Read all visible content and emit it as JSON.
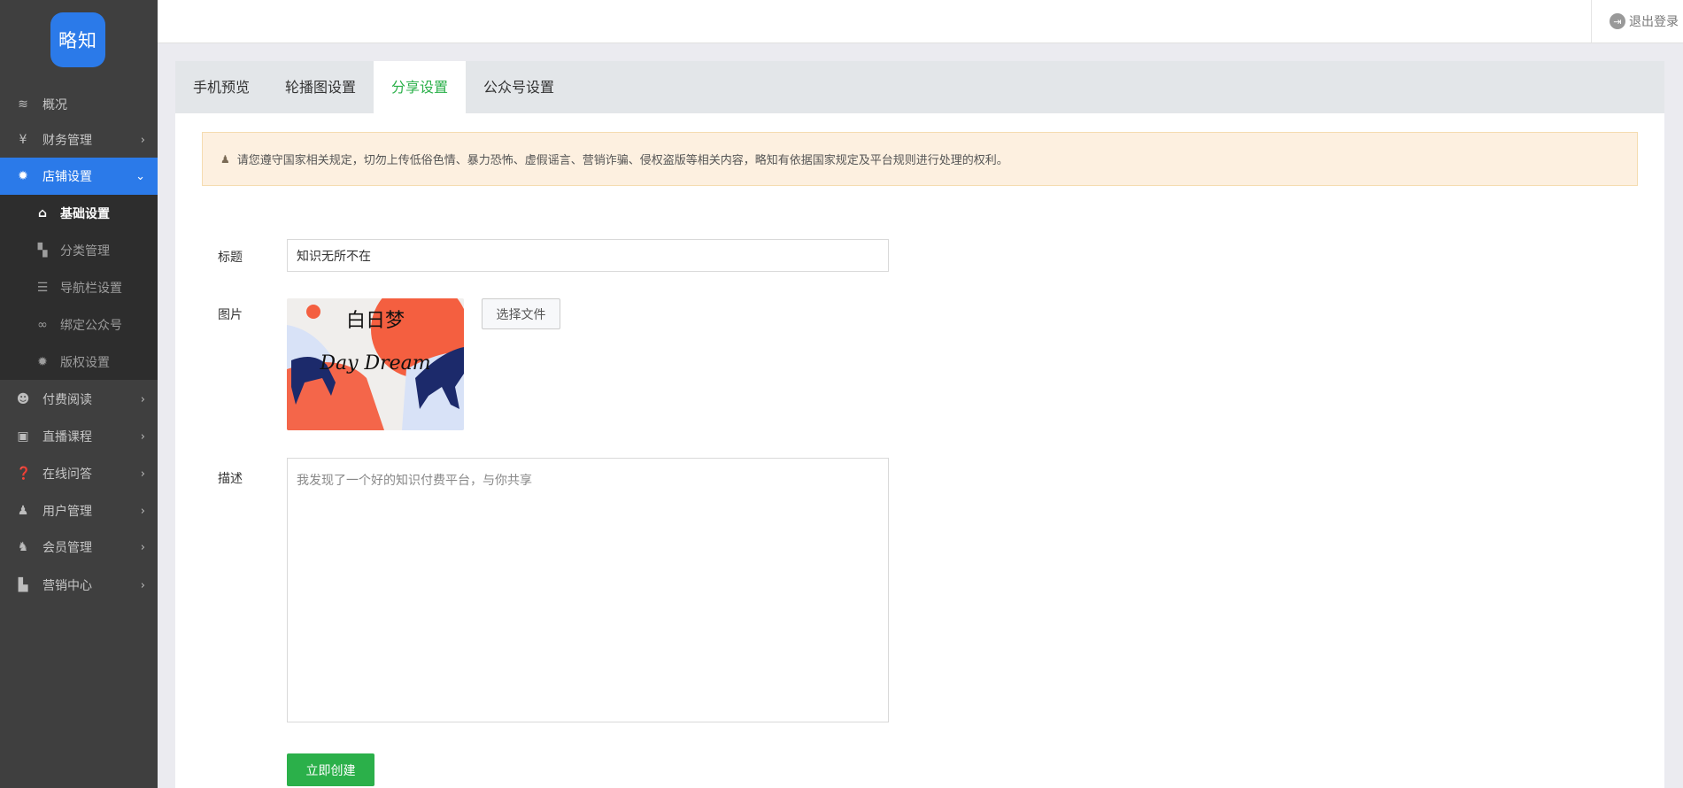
{
  "logo": {
    "text": "略知"
  },
  "topbar": {
    "logout_label": "退出登录",
    "logout_icon": "logout-icon"
  },
  "sidebar": {
    "items": [
      {
        "label": "概况",
        "icon": "layers-icon"
      },
      {
        "label": "财务管理",
        "icon": "finance-icon"
      },
      {
        "label": "店铺设置",
        "icon": "gear-icon",
        "active": true
      },
      {
        "label": "付费阅读",
        "icon": "reading-icon"
      },
      {
        "label": "直播课程",
        "icon": "live-icon"
      },
      {
        "label": "在线问答",
        "icon": "qa-icon"
      },
      {
        "label": "用户管理",
        "icon": "user-icon"
      },
      {
        "label": "会员管理",
        "icon": "member-icon"
      },
      {
        "label": "营销中心",
        "icon": "chart-icon"
      }
    ],
    "subitems": [
      {
        "label": "基础设置",
        "icon": "home-gear-icon",
        "active": true
      },
      {
        "label": "分类管理",
        "icon": "category-icon"
      },
      {
        "label": "导航栏设置",
        "icon": "list-icon"
      },
      {
        "label": "绑定公众号",
        "icon": "link-icon"
      },
      {
        "label": "版权设置",
        "icon": "gear-icon"
      }
    ]
  },
  "tabs": [
    {
      "label": "手机预览"
    },
    {
      "label": "轮播图设置"
    },
    {
      "label": "分享设置",
      "active": true
    },
    {
      "label": "公众号设置"
    }
  ],
  "notice": {
    "text": "请您遵守国家相关规定，切勿上传低俗色情、暴力恐怖、虚假谣言、营销诈骗、侵权盗版等相关内容，略知有依据国家规定及平台规则进行处理的权利。"
  },
  "form": {
    "title_label": "标题",
    "title_value": "知识无所不在",
    "image_label": "图片",
    "image_artwork_text": "白日梦 Day Dream",
    "choose_file_label": "选择文件",
    "desc_label": "描述",
    "desc_placeholder": "我发现了一个好的知识付费平台，与你共享",
    "submit_label": "立即创建"
  },
  "colors": {
    "sidebar": "#3f3f3f",
    "accent_blue": "#2b7ae9",
    "active_tab": "#2bb04a",
    "button_green": "#2bb04a",
    "notice_bg": "#fdf0e0"
  }
}
